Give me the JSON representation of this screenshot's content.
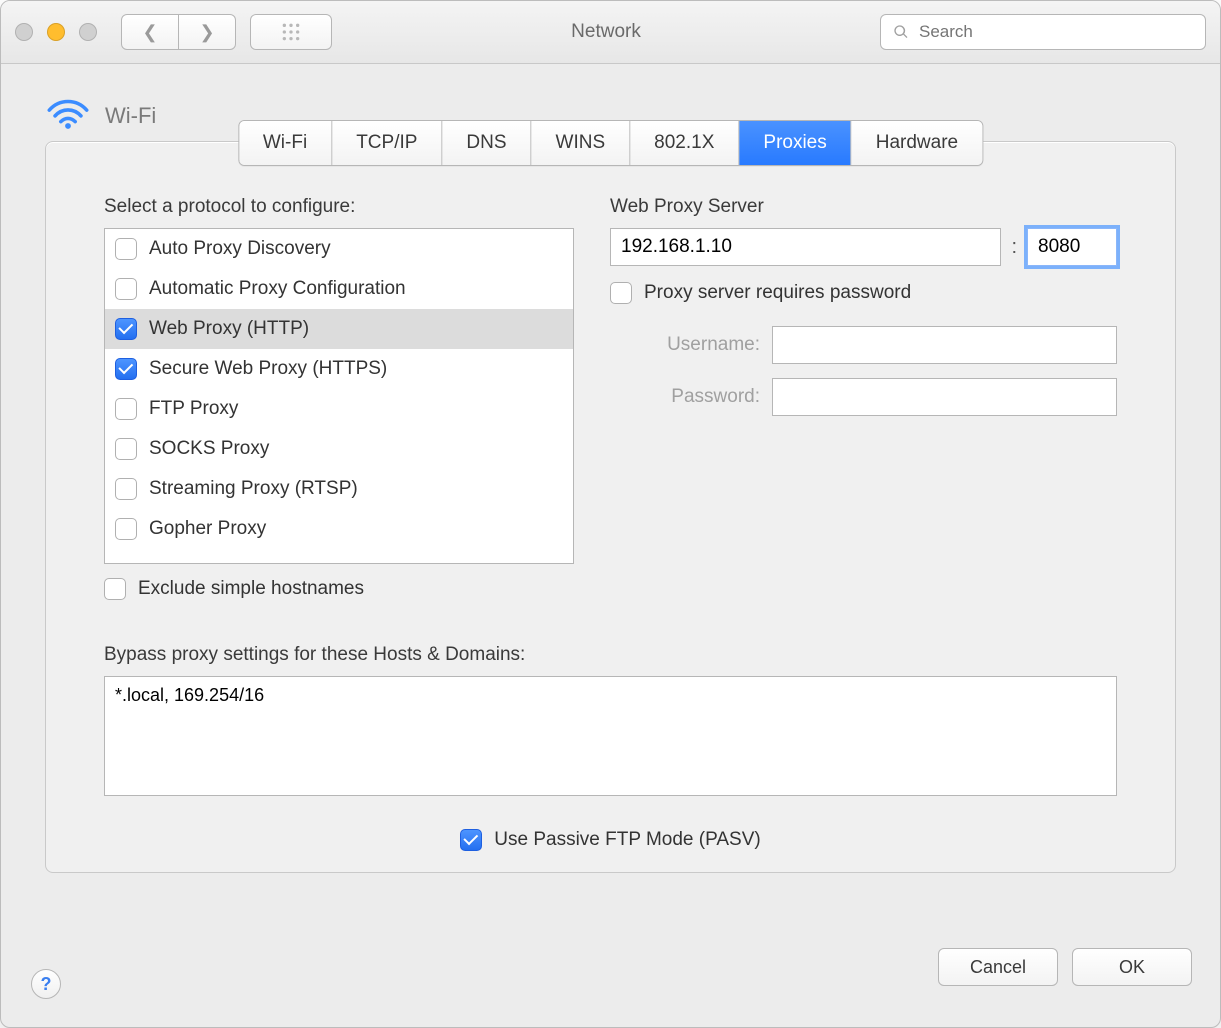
{
  "window": {
    "title": "Network",
    "search_placeholder": "Search"
  },
  "connection": {
    "name": "Wi-Fi"
  },
  "tabs": [
    {
      "label": "Wi-Fi"
    },
    {
      "label": "TCP/IP"
    },
    {
      "label": "DNS"
    },
    {
      "label": "WINS"
    },
    {
      "label": "802.1X"
    },
    {
      "label": "Proxies"
    },
    {
      "label": "Hardware"
    }
  ],
  "active_tab_label": "Proxies",
  "proxies": {
    "select_label": "Select a protocol to configure:",
    "protocols": {
      "auto_discovery": {
        "label": "Auto Proxy Discovery",
        "checked": false,
        "selected": false
      },
      "auto_config": {
        "label": "Automatic Proxy Configuration",
        "checked": false,
        "selected": false
      },
      "http": {
        "label": "Web Proxy (HTTP)",
        "checked": true,
        "selected": true
      },
      "https": {
        "label": "Secure Web Proxy (HTTPS)",
        "checked": true,
        "selected": false
      },
      "ftp": {
        "label": "FTP Proxy",
        "checked": false,
        "selected": false
      },
      "socks": {
        "label": "SOCKS Proxy",
        "checked": false,
        "selected": false
      },
      "rtsp": {
        "label": "Streaming Proxy (RTSP)",
        "checked": false,
        "selected": false
      },
      "gopher": {
        "label": "Gopher Proxy",
        "checked": false,
        "selected": false
      }
    },
    "server_section_label": "Web Proxy Server",
    "server_address": "192.168.1.10",
    "server_port": "8080",
    "requires_password_label": "Proxy server requires password",
    "requires_password_checked": false,
    "username_label": "Username:",
    "username_value": "",
    "password_label": "Password:",
    "password_value": "",
    "exclude_simple_label": "Exclude simple hostnames",
    "exclude_simple_checked": false,
    "bypass_label": "Bypass proxy settings for these Hosts & Domains:",
    "bypass_value": "*.local, 169.254/16",
    "pasv_label": "Use Passive FTP Mode (PASV)",
    "pasv_checked": true
  },
  "footer": {
    "cancel": "Cancel",
    "ok": "OK"
  }
}
